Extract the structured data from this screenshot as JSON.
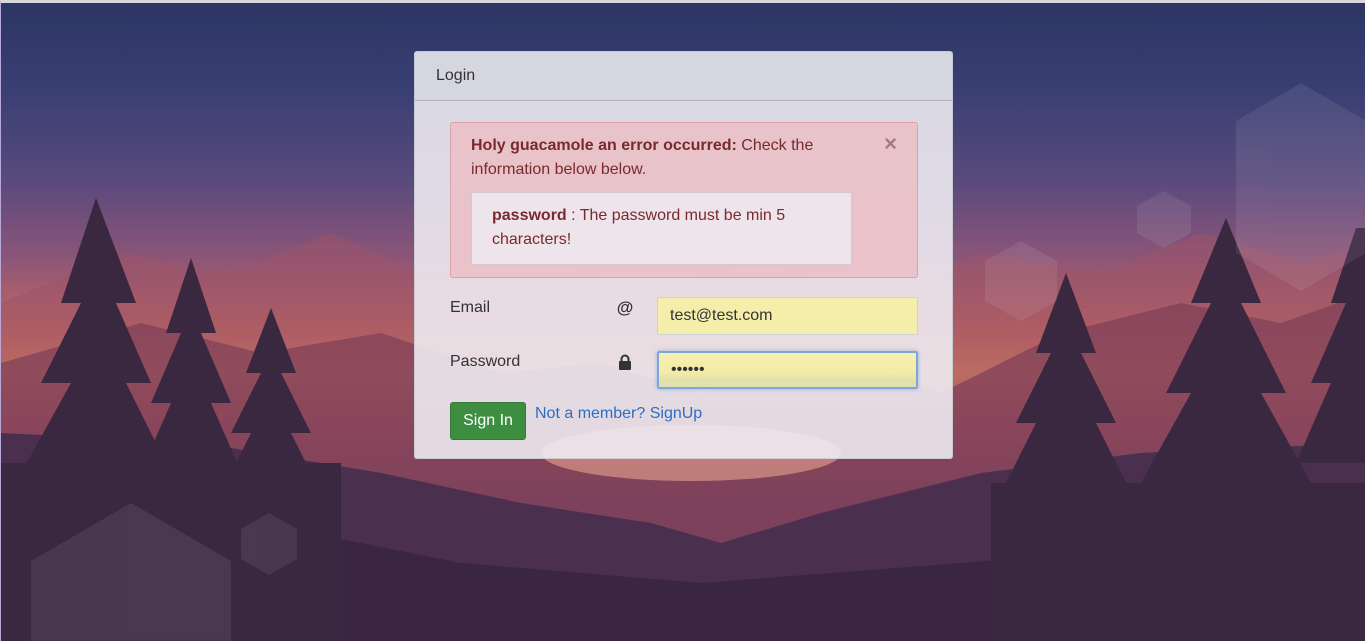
{
  "panel": {
    "heading": "Login"
  },
  "alert": {
    "title": "Holy guacamole an error occurred:",
    "message": " Check the information below below.",
    "close_glyph": "×",
    "detail": {
      "field": "password",
      "text": " : The password must be min 5 characters!"
    }
  },
  "form": {
    "email": {
      "label": "Email",
      "icon": "at-icon",
      "icon_glyph": "@",
      "value": "test@test.com"
    },
    "password": {
      "label": "Password",
      "icon": "lock-icon",
      "value": "••••••"
    },
    "sign_in_label": "Sign In",
    "signup_link_label": "Not a member? SignUp"
  },
  "colors": {
    "alert_text": "#7a2a2c",
    "button_green": "#3e8e42",
    "link_blue": "#2a6fc4",
    "autofill_yellow": "#f5eeab"
  }
}
